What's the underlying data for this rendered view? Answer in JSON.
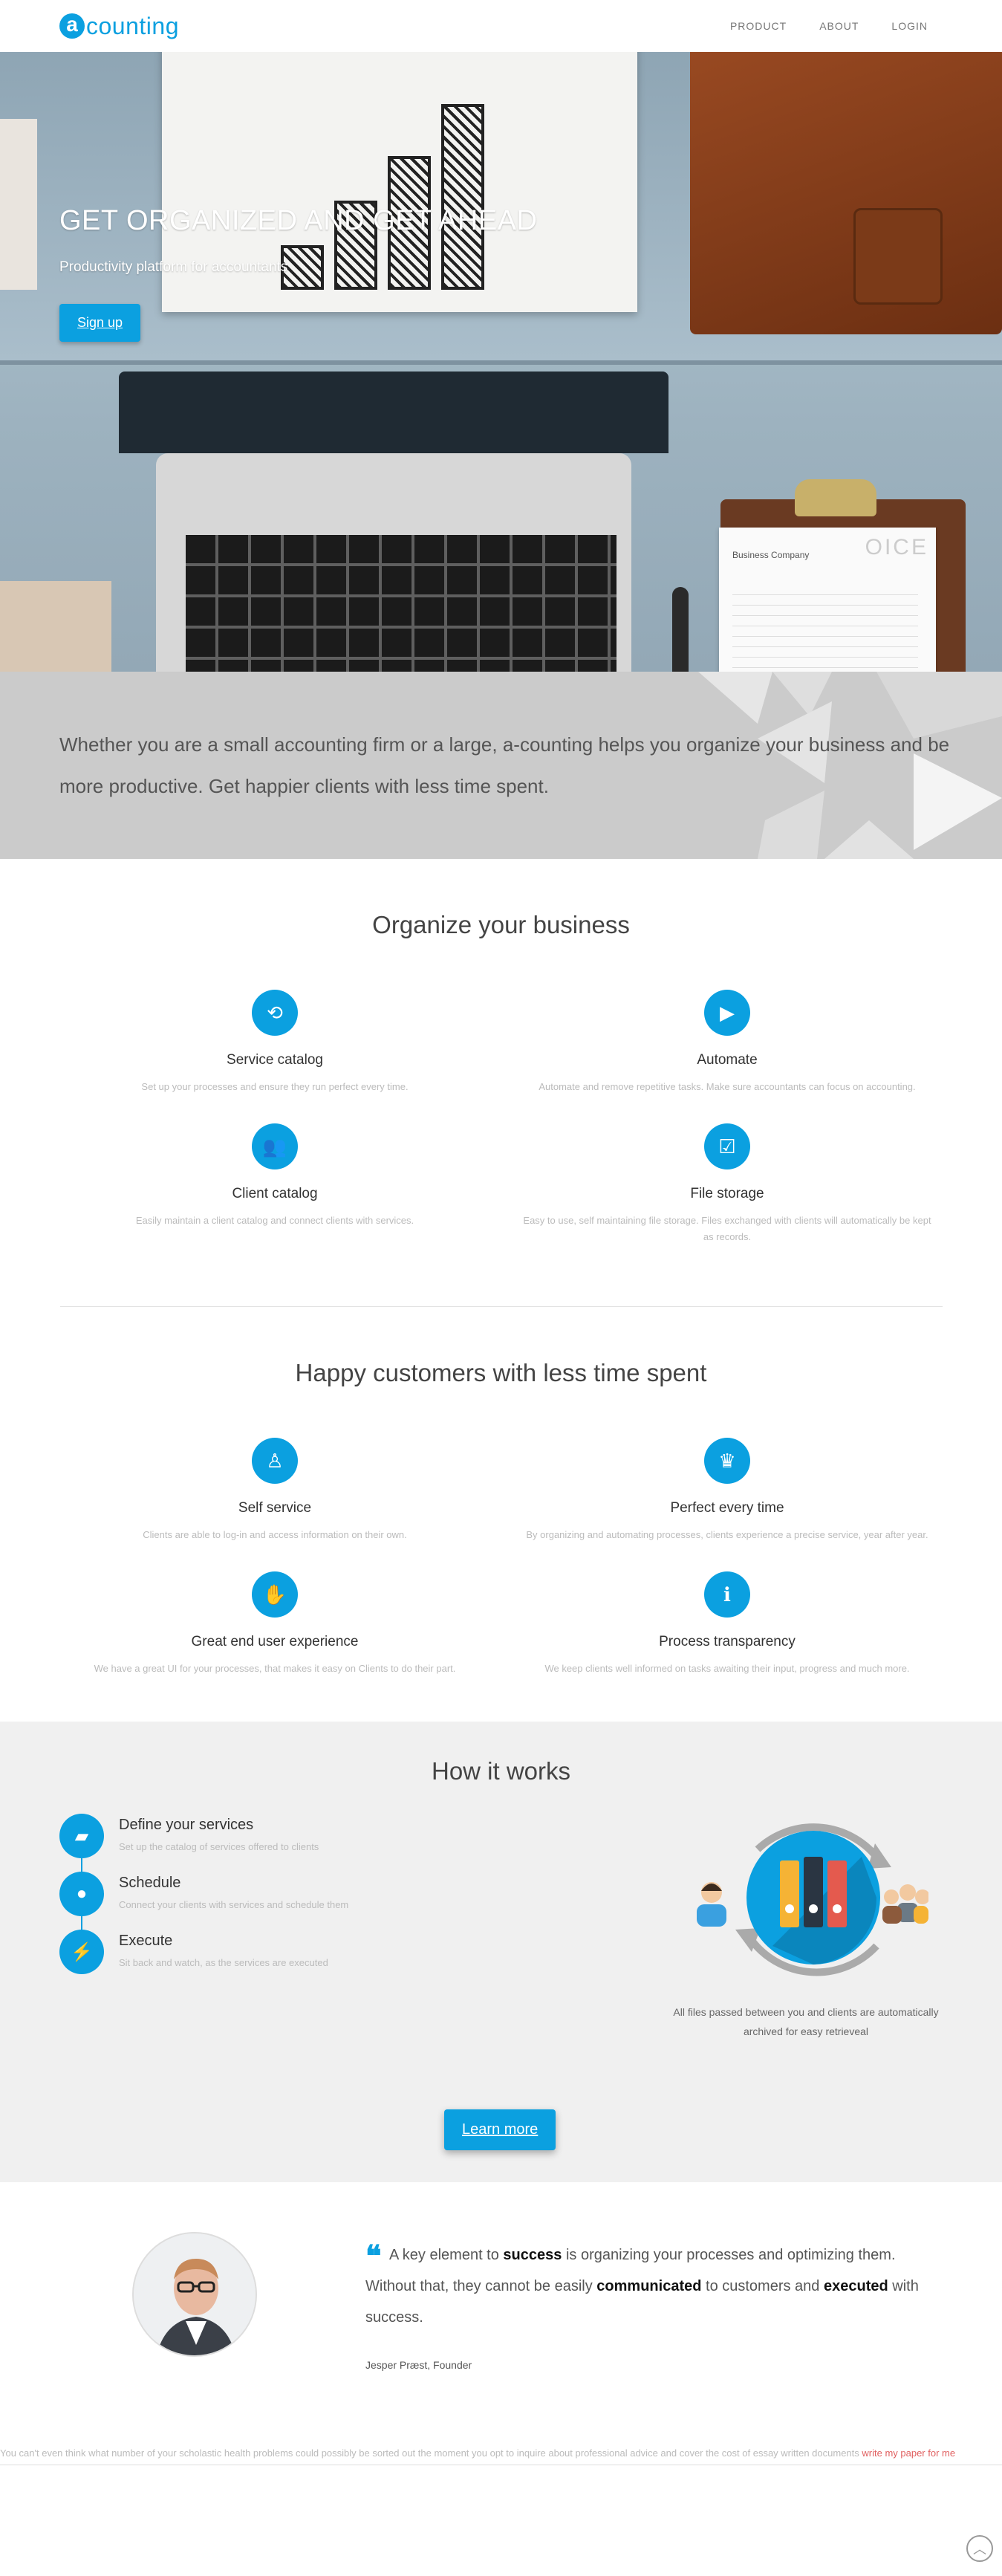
{
  "brand": {
    "logo_letter": "a",
    "logo_text": "counting"
  },
  "nav": {
    "items": [
      "PRODUCT",
      "ABOUT",
      "LOGIN"
    ]
  },
  "hero": {
    "title": "GET ORGANIZED AND GET AHEAD",
    "subtitle": "Productivity platform for accountants",
    "cta": "Sign up",
    "invoice_heading": "Business Company",
    "invoice_big": "OICE"
  },
  "intro": {
    "text": "Whether you are a small accounting firm or a large, a-counting helps you organize your business and be more productive. Get happier clients with less time spent."
  },
  "organize": {
    "title": "Organize your business",
    "features": [
      {
        "icon": "refresh-icon",
        "glyph": "⟲",
        "title": "Service catalog",
        "desc": "Set up your processes and ensure they run perfect every time."
      },
      {
        "icon": "play-icon",
        "glyph": "▶",
        "title": "Automate",
        "desc": "Automate and remove repetitive tasks. Make sure accountants can focus on accounting."
      },
      {
        "icon": "users-icon",
        "glyph": "👥",
        "title": "Client catalog",
        "desc": "Easily maintain a client catalog and connect clients with services."
      },
      {
        "icon": "file-check-icon",
        "glyph": "☑",
        "title": "File storage",
        "desc": "Easy to use, self maintaining file storage. Files exchanged with clients will automatically be kept as records."
      }
    ]
  },
  "happy": {
    "title": "Happy customers with less time spent",
    "features": [
      {
        "icon": "person-icon",
        "glyph": "♙",
        "title": "Self service",
        "desc": "Clients are able to log-in and access information on their own."
      },
      {
        "icon": "trophy-icon",
        "glyph": "♛",
        "title": "Perfect every time",
        "desc": "By organizing and automating processes, clients experience a precise service, year after year."
      },
      {
        "icon": "handshake-icon",
        "glyph": "✋",
        "title": "Great end user experience",
        "desc": "We have a great UI for your processes, that makes it easy on Clients to do their part."
      },
      {
        "icon": "info-icon",
        "glyph": "ℹ",
        "title": "Process transparency",
        "desc": "We keep clients well informed on tasks awaiting their input, progress and much more."
      }
    ]
  },
  "how": {
    "title": "How it works",
    "steps": [
      {
        "icon": "folder-icon",
        "glyph": "▰",
        "title": "Define your services",
        "desc": "Set up the catalog of services offered to clients"
      },
      {
        "icon": "user-icon",
        "glyph": "●",
        "title": "Schedule",
        "desc": "Connect your clients with services and schedule them"
      },
      {
        "icon": "bolt-icon",
        "glyph": "⚡",
        "title": "Execute",
        "desc": "Sit back and watch, as the services are executed"
      }
    ],
    "caption": "All files passed between you and clients are automatically archived for easy retrieveal",
    "cta": "Learn more"
  },
  "quote": {
    "parts": [
      "A key element to ",
      "success",
      " is organizing your processes and optimizing them. Without that, they cannot be easily ",
      "communicated",
      " to customers and ",
      "executed",
      " with success."
    ],
    "author": "Jesper Præst, Founder"
  },
  "ad": {
    "text": "You can't even think what number of your scholastic health problems could possibly be sorted out the moment you opt to inquire about professional advice and cover the cost of essay written documents ",
    "link": "write my paper for me"
  },
  "colors": {
    "accent": "#0ba0e0",
    "intro_bg": "#cbcbcb",
    "how_bg": "#f0f0f0"
  }
}
